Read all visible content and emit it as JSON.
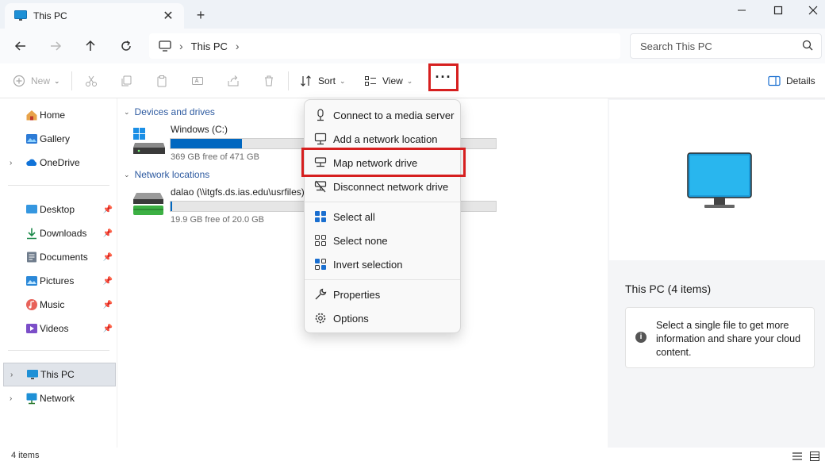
{
  "tab": {
    "title": "This PC",
    "close": "✕",
    "new": "+"
  },
  "address": {
    "path": [
      "This PC"
    ],
    "search_placeholder": "Search This PC"
  },
  "commandbar": {
    "new_label": "New",
    "sort_label": "Sort",
    "view_label": "View",
    "more_label": "···",
    "details_label": "Details"
  },
  "sidebar": {
    "home": "Home",
    "gallery": "Gallery",
    "onedrive": "OneDrive",
    "pinned": [
      "Desktop",
      "Downloads",
      "Documents",
      "Pictures",
      "Music",
      "Videos"
    ],
    "this_pc": "This PC",
    "network": "Network"
  },
  "main": {
    "devices_header": "Devices and drives",
    "network_header": "Network locations",
    "drives": [
      {
        "name": "Windows (C:)",
        "free": "369 GB free of 471 GB",
        "used_fraction": 0.22
      },
      {
        "name": "dalao (\\\\itgfs.ds.ias.edu\\usrfiles) (I:",
        "free": "19.9 GB free of 20.0 GB",
        "used_fraction": 0.005
      }
    ]
  },
  "menu": {
    "items": [
      "Connect to a media server",
      "Add a network location",
      "Map network drive",
      "Disconnect network drive",
      "Select all",
      "Select none",
      "Invert selection",
      "Properties",
      "Options"
    ]
  },
  "details": {
    "title": "This PC (4 items)",
    "info": "Select a single file to get more information and share your cloud content."
  },
  "status": {
    "count": "4 items"
  },
  "colors": {
    "accent": "#0067c0",
    "highlight": "#d61f1f",
    "network_drive": "#3cb043"
  }
}
